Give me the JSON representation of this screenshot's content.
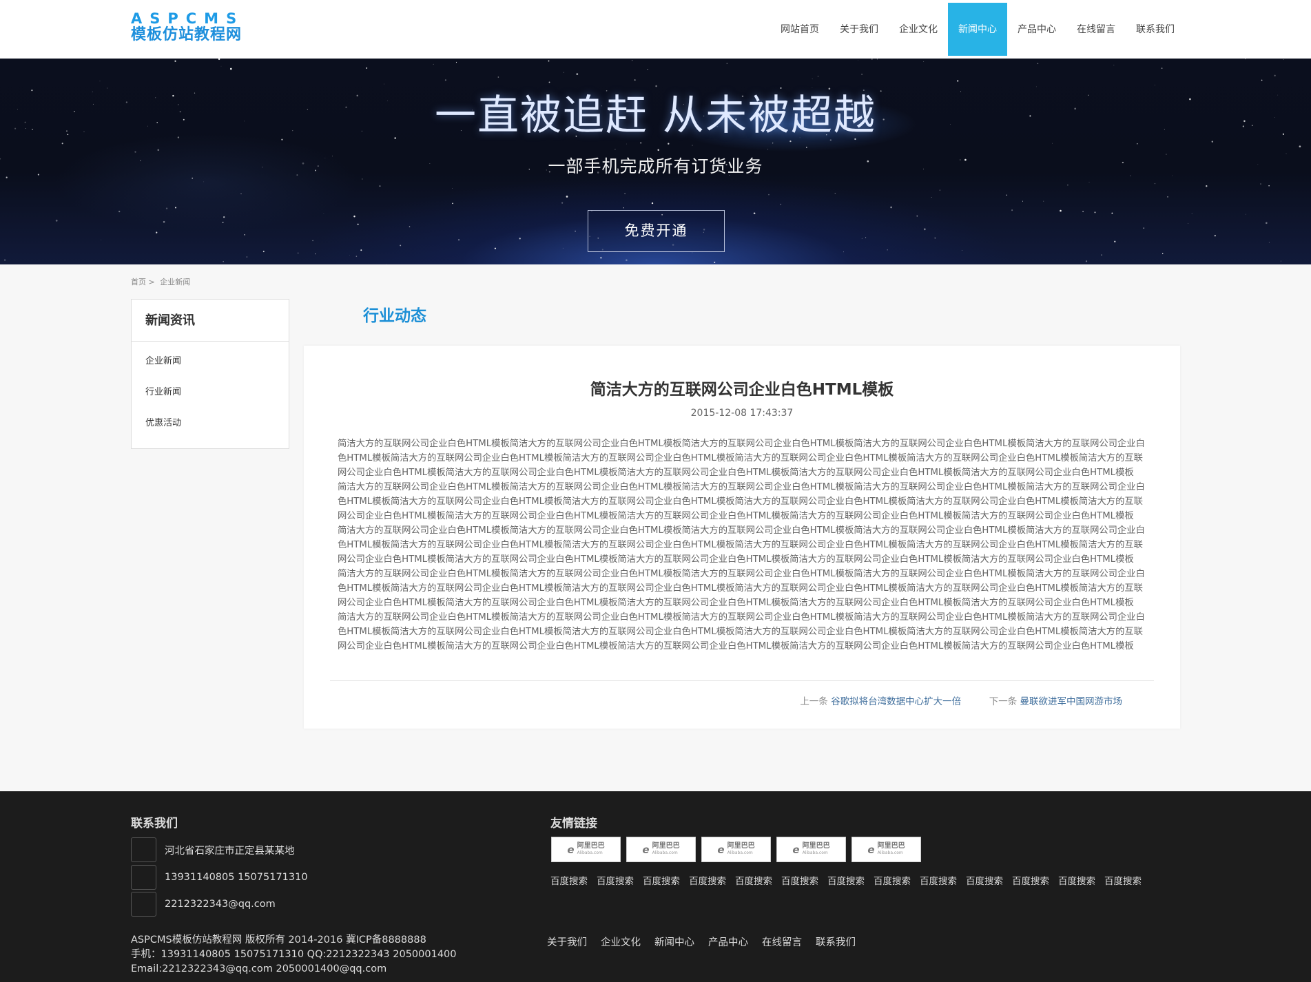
{
  "header": {
    "logo_top": "ASPCMS",
    "logo_bottom": "模板仿站教程网",
    "nav": [
      {
        "label": "网站首页",
        "active": false
      },
      {
        "label": "关于我们",
        "active": false
      },
      {
        "label": "企业文化",
        "active": false
      },
      {
        "label": "新闻中心",
        "active": true
      },
      {
        "label": "产品中心",
        "active": false
      },
      {
        "label": "在线留言",
        "active": false
      },
      {
        "label": "联系我们",
        "active": false
      }
    ]
  },
  "banner": {
    "title": "一直被追赶 从未被超越",
    "subtitle": "一部手机完成所有订货业务",
    "button_label": "免费开通"
  },
  "breadcrumb": {
    "home": "首页",
    "separator": ">",
    "current": "企业新闻"
  },
  "sidebar": {
    "title": "新闻资讯",
    "items": [
      "企业新闻",
      "行业新闻",
      "优惠活动"
    ]
  },
  "section_title": "行业动态",
  "article": {
    "title": "简洁大方的互联网公司企业白色HTML模板",
    "date": "2015-12-08 17:43:37",
    "paragraphs": [
      "简洁大方的互联网公司企业白色HTML模板简洁大方的互联网公司企业白色HTML模板简洁大方的互联网公司企业白色HTML模板简洁大方的互联网公司企业白色HTML模板简洁大方的互联网公司企业白色HTML模板简洁大方的互联网公司企业白色HTML模板简洁大方的互联网公司企业白色HTML模板简洁大方的互联网公司企业白色HTML模板简洁大方的互联网公司企业白色HTML模板简洁大方的互联网公司企业白色HTML模板简洁大方的互联网公司企业白色HTML模板简洁大方的互联网公司企业白色HTML模板简洁大方的互联网公司企业白色HTML模板简洁大方的互联网公司企业白色HTML模板",
      "简洁大方的互联网公司企业白色HTML模板简洁大方的互联网公司企业白色HTML模板简洁大方的互联网公司企业白色HTML模板简洁大方的互联网公司企业白色HTML模板简洁大方的互联网公司企业白色HTML模板简洁大方的互联网公司企业白色HTML模板简洁大方的互联网公司企业白色HTML模板简洁大方的互联网公司企业白色HTML模板简洁大方的互联网公司企业白色HTML模板简洁大方的互联网公司企业白色HTML模板简洁大方的互联网公司企业白色HTML模板简洁大方的互联网公司企业白色HTML模板简洁大方的互联网公司企业白色HTML模板简洁大方的互联网公司企业白色HTML模板",
      "简洁大方的互联网公司企业白色HTML模板简洁大方的互联网公司企业白色HTML模板简洁大方的互联网公司企业白色HTML模板简洁大方的互联网公司企业白色HTML模板简洁大方的互联网公司企业白色HTML模板简洁大方的互联网公司企业白色HTML模板简洁大方的互联网公司企业白色HTML模板简洁大方的互联网公司企业白色HTML模板简洁大方的互联网公司企业白色HTML模板简洁大方的互联网公司企业白色HTML模板简洁大方的互联网公司企业白色HTML模板简洁大方的互联网公司企业白色HTML模板简洁大方的互联网公司企业白色HTML模板简洁大方的互联网公司企业白色HTML模板",
      "简洁大方的互联网公司企业白色HTML模板简洁大方的互联网公司企业白色HTML模板简洁大方的互联网公司企业白色HTML模板简洁大方的互联网公司企业白色HTML模板简洁大方的互联网公司企业白色HTML模板简洁大方的互联网公司企业白色HTML模板简洁大方的互联网公司企业白色HTML模板简洁大方的互联网公司企业白色HTML模板简洁大方的互联网公司企业白色HTML模板简洁大方的互联网公司企业白色HTML模板简洁大方的互联网公司企业白色HTML模板简洁大方的互联网公司企业白色HTML模板简洁大方的互联网公司企业白色HTML模板简洁大方的互联网公司企业白色HTML模板",
      "简洁大方的互联网公司企业白色HTML模板简洁大方的互联网公司企业白色HTML模板简洁大方的互联网公司企业白色HTML模板简洁大方的互联网公司企业白色HTML模板简洁大方的互联网公司企业白色HTML模板简洁大方的互联网公司企业白色HTML模板简洁大方的互联网公司企业白色HTML模板简洁大方的互联网公司企业白色HTML模板简洁大方的互联网公司企业白色HTML模板简洁大方的互联网公司企业白色HTML模板简洁大方的互联网公司企业白色HTML模板简洁大方的互联网公司企业白色HTML模板简洁大方的互联网公司企业白色HTML模板简洁大方的互联网公司企业白色HTML模板"
    ],
    "prev_label": "上一条",
    "prev_title": "谷歌拟将台湾数据中心扩大一倍",
    "next_label": "下一条",
    "next_title": "曼联欲进军中国网游市场"
  },
  "footer": {
    "contact_title": "联系我们",
    "address": "河北省石家庄市正定县某某地",
    "phone": "13931140805 15075171310",
    "email": "2212322343@qq.com",
    "links_title": "友情链接",
    "partner_logos": [
      {
        "mark": "e",
        "cn": "阿里巴巴",
        "en": "Alibaba.com"
      },
      {
        "mark": "e",
        "cn": "阿里巴巴",
        "en": "Alibaba.com"
      },
      {
        "mark": "e",
        "cn": "阿里巴巴",
        "en": "Alibaba.com"
      },
      {
        "mark": "e",
        "cn": "阿里巴巴",
        "en": "Alibaba.com"
      },
      {
        "mark": "e",
        "cn": "阿里巴巴",
        "en": "Alibaba.com"
      }
    ],
    "search_links": [
      "百度搜索",
      "百度搜索",
      "百度搜索",
      "百度搜索",
      "百度搜索",
      "百度搜索",
      "百度搜索",
      "百度搜索",
      "百度搜索",
      "百度搜索",
      "百度搜索",
      "百度搜索",
      "百度搜索"
    ],
    "copyright_lines": [
      "ASPCMS模板仿站教程网 版权所有 2014-2016 冀ICP备8888888",
      "手机：13931140805 15075171310 QQ:2212322343 2050001400",
      "Email:2212322343@qq.com 2050001400@qq.com"
    ],
    "nav": [
      "关于我们",
      "企业文化",
      "新闻中心",
      "产品中心",
      "在线留言",
      "联系我们"
    ]
  }
}
